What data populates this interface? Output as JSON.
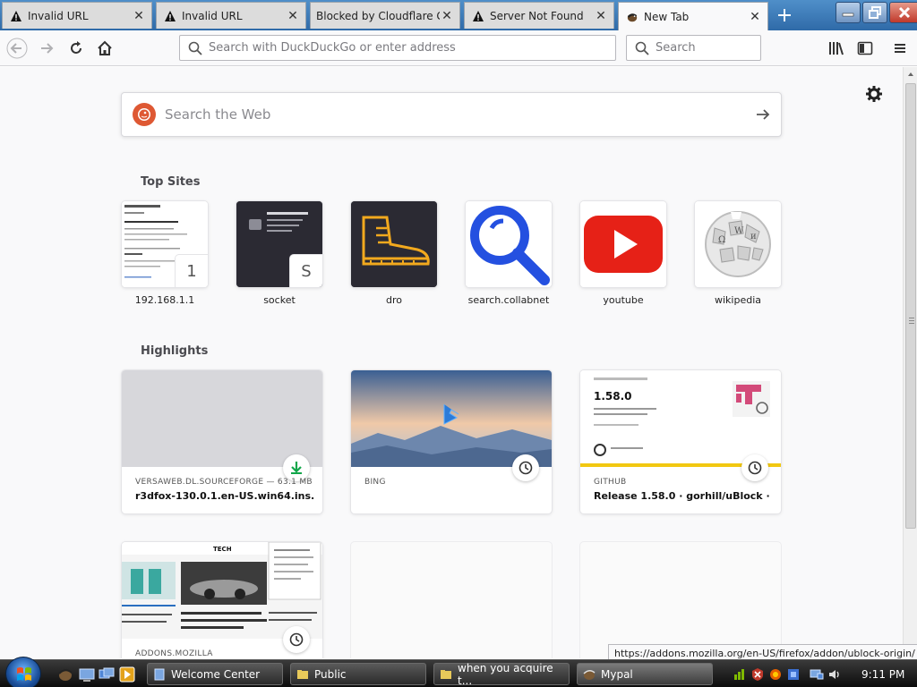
{
  "tabs": [
    {
      "title": "Invalid URL",
      "icon": "warning-icon"
    },
    {
      "title": "Invalid URL",
      "icon": "warning-icon"
    },
    {
      "title": "Blocked by Cloudflare Ga",
      "icon": "none"
    },
    {
      "title": "Server Not Found",
      "icon": "warning-icon"
    },
    {
      "title": "New Tab",
      "icon": "firefox-logo-icon",
      "active": true
    }
  ],
  "navbar": {
    "url_placeholder": "Search with DuckDuckGo or enter address",
    "search_placeholder": "Search"
  },
  "newtab": {
    "web_search_placeholder": "Search the Web",
    "top_sites_title": "Top Sites",
    "top_sites": [
      {
        "label": "192.168.1.1",
        "letter": "1"
      },
      {
        "label": "socket",
        "letter": "S"
      },
      {
        "label": "dro",
        "letter": ""
      },
      {
        "label": "search.collabnet",
        "letter": ""
      },
      {
        "label": "youtube",
        "letter": ""
      },
      {
        "label": "wikipedia",
        "letter": ""
      }
    ],
    "highlights_title": "Highlights",
    "highlights": [
      {
        "source": "VERSAWEB.DL.SOURCEFORGE — 63.1 MB",
        "title": "r3dfox-130.0.1.en-US.win64.ins...",
        "badge": "download-icon"
      },
      {
        "source": "BING",
        "title": "",
        "badge": "clock-icon"
      },
      {
        "source": "GITHUB",
        "title": "Release 1.58.0 · gorhill/uBlock · ...",
        "badge": "clock-icon",
        "thumb_version": "1.58.0"
      },
      {
        "source": "ADDONS.MOZILLA",
        "title": "",
        "badge": "clock-icon"
      }
    ]
  },
  "status_url": "https://addons.mozilla.org/en-US/firefox/addon/ublock-origin/",
  "taskbar": {
    "tasks": [
      {
        "label": "Welcome Center"
      },
      {
        "label": "Public"
      },
      {
        "label": "when you acquire t..."
      },
      {
        "label": "Mypal"
      }
    ],
    "clock": "9:11 PM"
  },
  "colors": {
    "accent": "#2f6aa8",
    "youtube_red": "#e62117",
    "collab_blue": "#2450e0",
    "download_green": "#12a64a"
  }
}
